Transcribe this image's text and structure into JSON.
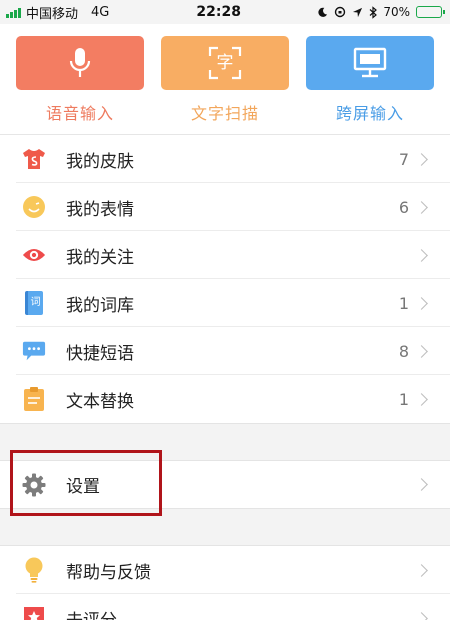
{
  "status_bar": {
    "carrier": "中国移动",
    "network": "4G",
    "time": "22:28",
    "battery_text": "70%",
    "battery_level": 0.7
  },
  "top_actions": [
    {
      "label": "语音输入",
      "icon": "microphone-icon",
      "tile_color": "#f37d62",
      "label_color": "#ee7b5f"
    },
    {
      "label": "文字扫描",
      "icon": "text-scan-icon",
      "tile_color": "#f8ad63",
      "label_color": "#f2a65b",
      "icon_text": "字"
    },
    {
      "label": "跨屏输入",
      "icon": "monitor-icon",
      "tile_color": "#5aa9ef",
      "label_color": "#4a9de6"
    }
  ],
  "menu_group1": [
    {
      "label": "我的皮肤",
      "count": "7",
      "icon": "tshirt-icon"
    },
    {
      "label": "我的表情",
      "count": "6",
      "icon": "smiley-icon"
    },
    {
      "label": "我的关注",
      "count": "",
      "icon": "eye-icon"
    },
    {
      "label": "我的词库",
      "count": "1",
      "icon": "dictionary-icon",
      "icon_text": "词"
    },
    {
      "label": "快捷短语",
      "count": "8",
      "icon": "chat-bubble-icon"
    },
    {
      "label": "文本替换",
      "count": "1",
      "icon": "clipboard-icon"
    }
  ],
  "settings_row": {
    "label": "设置",
    "icon": "gear-icon"
  },
  "menu_group3": [
    {
      "label": "帮助与反馈",
      "icon": "lightbulb-icon"
    },
    {
      "label": "去评分",
      "icon": "star-icon"
    }
  ],
  "colors": {
    "highlight": "#b0141a",
    "signal": "#1aa84a"
  }
}
